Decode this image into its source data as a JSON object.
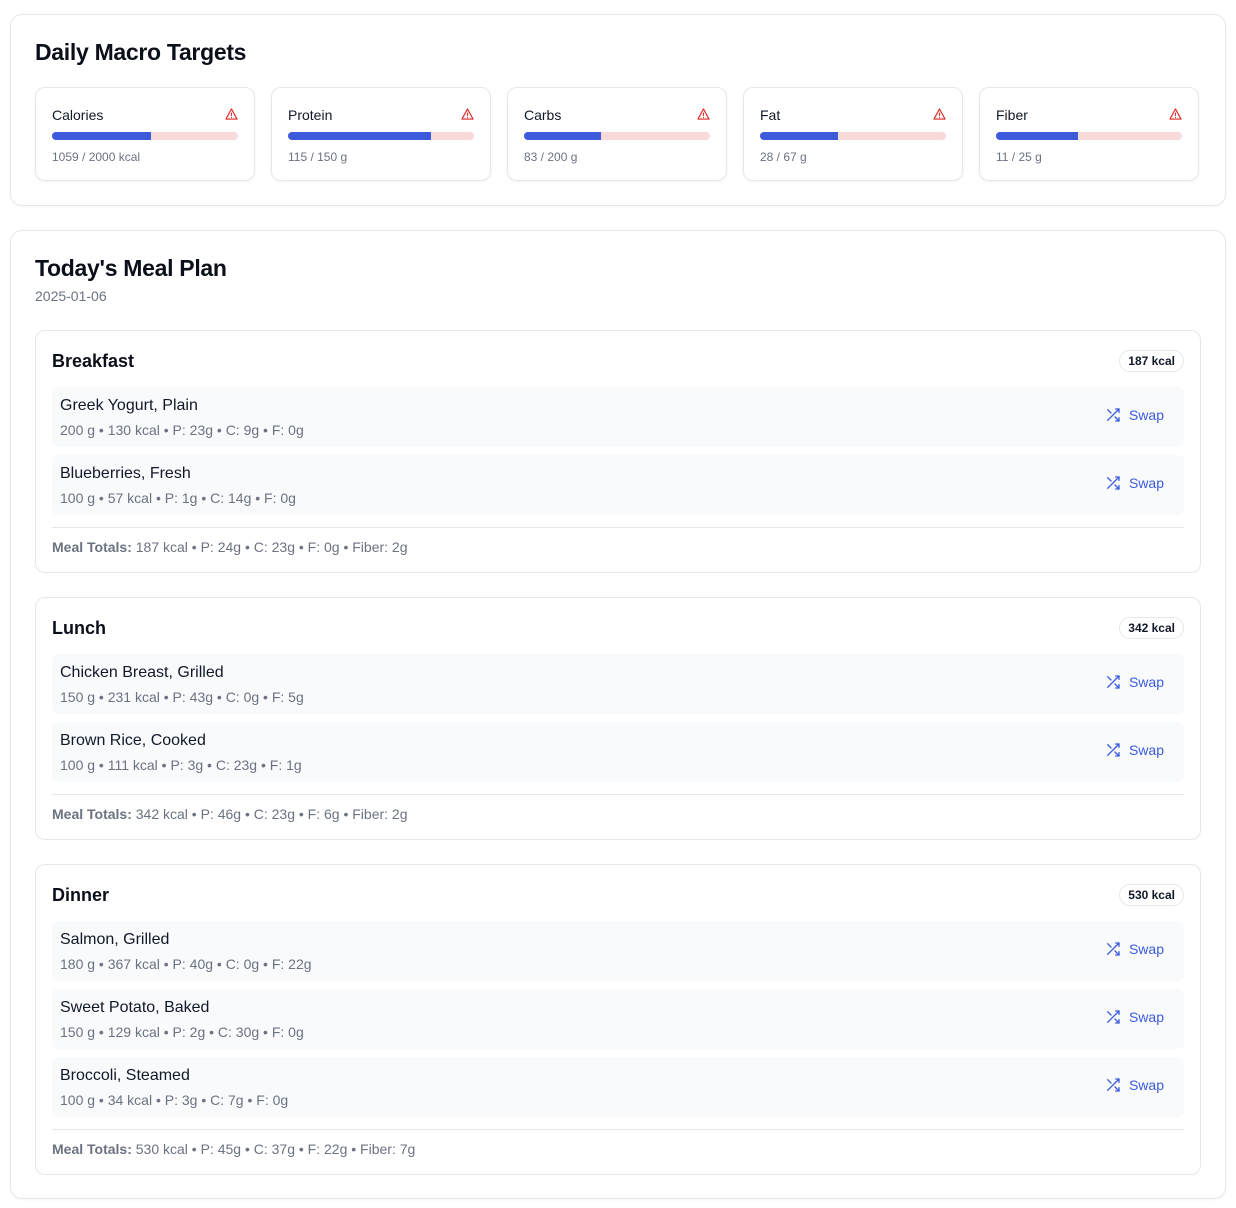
{
  "macros": {
    "title": "Daily Macro Targets",
    "items": [
      {
        "name": "Calories",
        "current": 1059,
        "target": 2000,
        "value_text": "1059 / 2000 kcal",
        "progress": 0.53
      },
      {
        "name": "Protein",
        "current": 115,
        "target": 150,
        "value_text": "115 / 150 g",
        "progress": 0.77
      },
      {
        "name": "Carbs",
        "current": 83,
        "target": 200,
        "value_text": "83 / 200 g",
        "progress": 0.415
      },
      {
        "name": "Fat",
        "current": 28,
        "target": 67,
        "value_text": "28 / 67 g",
        "progress": 0.42
      },
      {
        "name": "Fiber",
        "current": 11,
        "target": 25,
        "value_text": "11 / 25 g",
        "progress": 0.44
      }
    ],
    "warning_icon": "alert-triangle-icon",
    "colors": {
      "fill": "#3b5bdb",
      "track": "#f8d9da",
      "warning": "#dc2626"
    }
  },
  "plan": {
    "title": "Today's Meal Plan",
    "date": "2025-01-06",
    "swap_label": "Swap",
    "swap_icon": "shuffle-icon",
    "totals_label": "Meal Totals:",
    "meals": [
      {
        "name": "Breakfast",
        "badge": "187 kcal",
        "foods": [
          {
            "name": "Greek Yogurt, Plain",
            "meta": "200 g • 130 kcal • P: 23g • C: 9g • F: 0g"
          },
          {
            "name": "Blueberries, Fresh",
            "meta": "100 g • 57 kcal • P: 1g • C: 14g • F: 0g"
          }
        ],
        "totals": "187 kcal • P: 24g • C: 23g • F: 0g • Fiber: 2g"
      },
      {
        "name": "Lunch",
        "badge": "342 kcal",
        "foods": [
          {
            "name": "Chicken Breast, Grilled",
            "meta": "150 g • 231 kcal • P: 43g • C: 0g • F: 5g"
          },
          {
            "name": "Brown Rice, Cooked",
            "meta": "100 g • 111 kcal • P: 3g • C: 23g • F: 1g"
          }
        ],
        "totals": "342 kcal • P: 46g • C: 23g • F: 6g • Fiber: 2g"
      },
      {
        "name": "Dinner",
        "badge": "530 kcal",
        "foods": [
          {
            "name": "Salmon, Grilled",
            "meta": "180 g • 367 kcal • P: 40g • C: 0g • F: 22g"
          },
          {
            "name": "Sweet Potato, Baked",
            "meta": "150 g • 129 kcal • P: 2g • C: 30g • F: 0g"
          },
          {
            "name": "Broccoli, Steamed",
            "meta": "100 g • 34 kcal • P: 3g • C: 7g • F: 0g"
          }
        ],
        "totals": "530 kcal • P: 45g • C: 37g • F: 22g • Fiber: 7g"
      }
    ]
  }
}
